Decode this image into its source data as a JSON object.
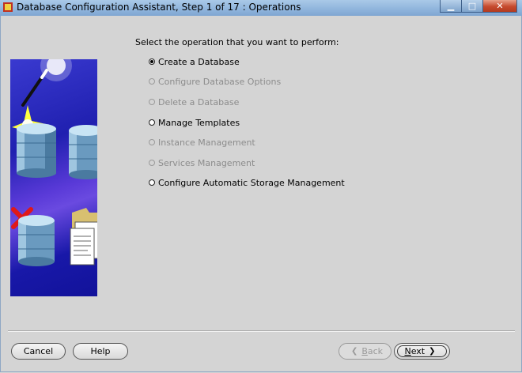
{
  "window": {
    "title": "Database Configuration Assistant, Step 1 of 17 : Operations",
    "controls": {
      "minimize": "▁",
      "maximize": "□",
      "close": "✕"
    }
  },
  "main": {
    "prompt": "Select the operation that you want to perform:",
    "operations": [
      {
        "label": "Create a Database",
        "selected": true,
        "enabled": true
      },
      {
        "label": "Configure Database Options",
        "selected": false,
        "enabled": false
      },
      {
        "label": "Delete a Database",
        "selected": false,
        "enabled": false
      },
      {
        "label": "Manage Templates",
        "selected": false,
        "enabled": true
      },
      {
        "label": "Instance Management",
        "selected": false,
        "enabled": false
      },
      {
        "label": "Services Management",
        "selected": false,
        "enabled": false
      },
      {
        "label": "Configure Automatic Storage Management",
        "selected": false,
        "enabled": true
      }
    ]
  },
  "footer": {
    "cancel_label": "Cancel",
    "help_label": "Help",
    "back_label_prefix": "",
    "back_mnemonic": "B",
    "back_label_rest": "ack",
    "next_mnemonic": "N",
    "next_label_rest": "ext"
  },
  "icons": {
    "illustration": [
      "wand-icon",
      "database-create-icon",
      "database-configure-icon",
      "database-delete-icon",
      "folder-templates-icon"
    ]
  },
  "colors": {
    "background": "#d4d4d4",
    "illustration_blue": "#2020b0",
    "check_red": "#d01010"
  }
}
